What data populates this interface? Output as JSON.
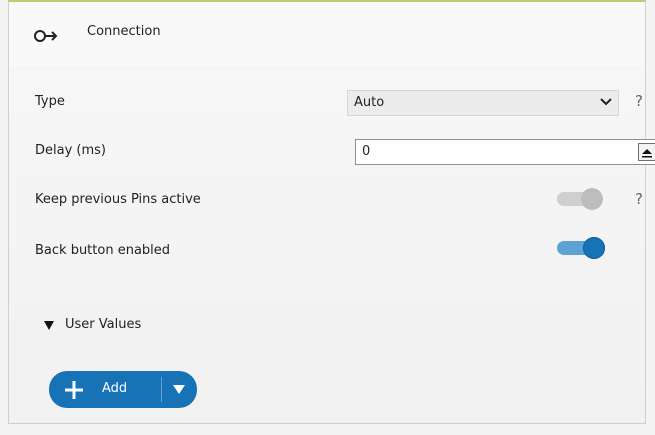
{
  "header": {
    "title": "Connection",
    "icon": "connection-icon"
  },
  "fields": {
    "type": {
      "label": "Type",
      "value": "Auto",
      "help": "?"
    },
    "delay": {
      "label": "Delay (ms)",
      "value": "0"
    },
    "keep_pins": {
      "label": "Keep previous Pins active",
      "help": "?",
      "checked": false
    },
    "back_button": {
      "label": "Back button enabled",
      "checked": true
    }
  },
  "user_values": {
    "label": "User Values",
    "add_label": "Add"
  },
  "colors": {
    "accent": "#1773b5",
    "header_line": "#b9cf6e",
    "toggle_off": "#cfcfcf"
  }
}
